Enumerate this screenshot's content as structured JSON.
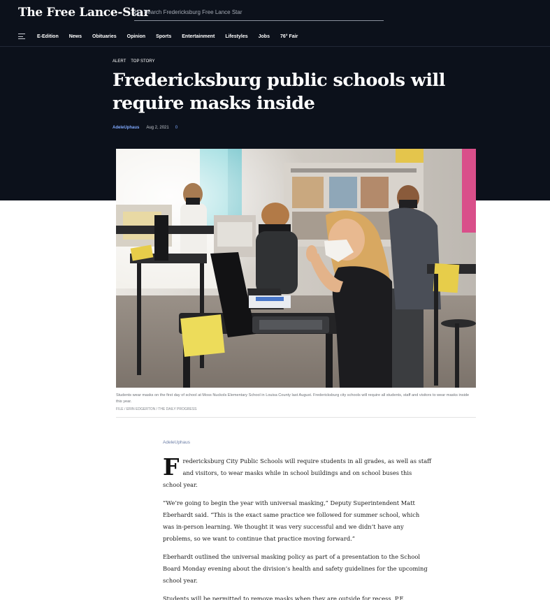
{
  "site": {
    "logo": "The Free Lance-Star",
    "search_placeholder": "Search Fredericksburg Free Lance Star"
  },
  "nav": {
    "items": [
      "E-Edition",
      "News",
      "Obituaries",
      "Opinion",
      "Sports",
      "Entertainment",
      "Lifestyles",
      "Jobs",
      "76° Fair"
    ]
  },
  "article": {
    "kickers": [
      "Alert",
      "Top Story"
    ],
    "headline": "Fredericksburg public schools will require masks inside",
    "byline_author": "AdeleUphaus",
    "date": "Aug 2, 2021",
    "comment_count": "0",
    "photo_caption": "Students wear masks on the first day of school at Moss Nuckols Elementary School in Louisa County last August. Fredericksburg city schools will require all students, staff and visitors to wear masks inside this year.",
    "photo_credit": "FILE / ERIN EDGERTON / THE DAILY PROGRESS",
    "author_line": "AdeleUphaus",
    "dropcap": "F",
    "paragraphs": [
      "redericksburg City Public Schools will require students in all grades, as well as staff and visitors, to wear masks while in school buildings and on school buses this school year.",
      "“We’re going to begin the year with universal masking,” Deputy Superintendent Matt Eberhardt said. “This is the exact same practice we followed for summer school, which was in-person learning. We thought it was very successful and we didn’t have any problems, so we want to continue that practice moving forward.”",
      "Eberhardt outlined the universal masking policy as part of a presentation to the School Board Monday evening about the division’s health and safety guidelines for the upcoming school year.",
      "Students will be permitted to remove masks when they are outside for recess, P.E."
    ]
  },
  "colors": {
    "header_bg": "#0c111b",
    "link_blue": "#7fa9ff"
  }
}
